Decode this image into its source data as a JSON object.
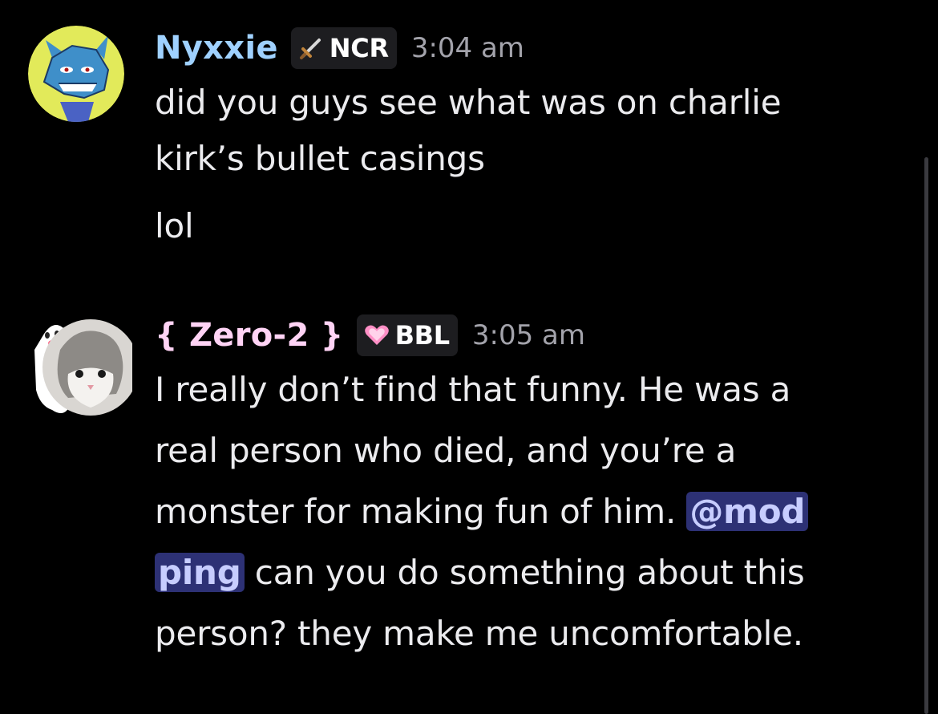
{
  "messages": [
    {
      "username": "Nyxxie",
      "username_color": "#9fd1ff",
      "tag": {
        "icon": "sword-icon",
        "label": "NCR"
      },
      "timestamp": "3:04 am",
      "lines": [
        "did you guys see what was on charlie",
        "kirk’s bullet casings",
        "lol"
      ]
    },
    {
      "username": "{ Zero-2 }",
      "username_color": "#ffd3f5",
      "tag": {
        "icon": "pink-heart-icon",
        "label": "BBL"
      },
      "timestamp": "3:05 am",
      "lines": [
        "I really don’t find that funny. He was a",
        "real person who died, and you’re a",
        "monster for making fun of him.",
        "can you do something about this",
        "person? they make me uncomfortable."
      ],
      "mention_part1": "@mod",
      "mention_part2": "ping"
    }
  ]
}
